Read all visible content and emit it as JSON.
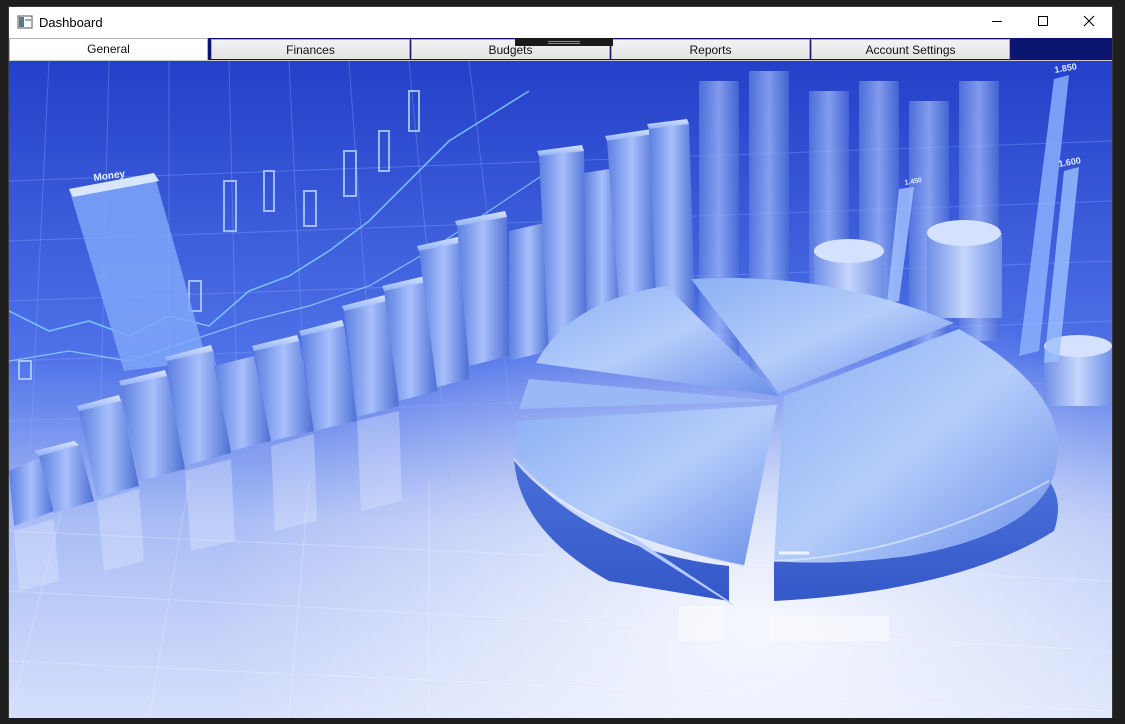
{
  "window": {
    "title": "Dashboard",
    "controls": {
      "minimize": "—",
      "maximize": "☐",
      "close": "✕"
    }
  },
  "tabs": [
    {
      "label": "General",
      "active": true
    },
    {
      "label": "Finances",
      "active": false
    },
    {
      "label": "Budgets",
      "active": false
    },
    {
      "label": "Reports",
      "active": false
    },
    {
      "label": "Account Settings",
      "active": false
    }
  ],
  "hero_image": {
    "labels": {
      "money": "Money",
      "v1": "1.850",
      "v2": "1.600",
      "v3": "1.450"
    },
    "colors": {
      "sky": "#2d4fd6",
      "floor": "#b9c8f6",
      "bars": "#6f94f0",
      "pie": "#8aa8f4"
    }
  }
}
